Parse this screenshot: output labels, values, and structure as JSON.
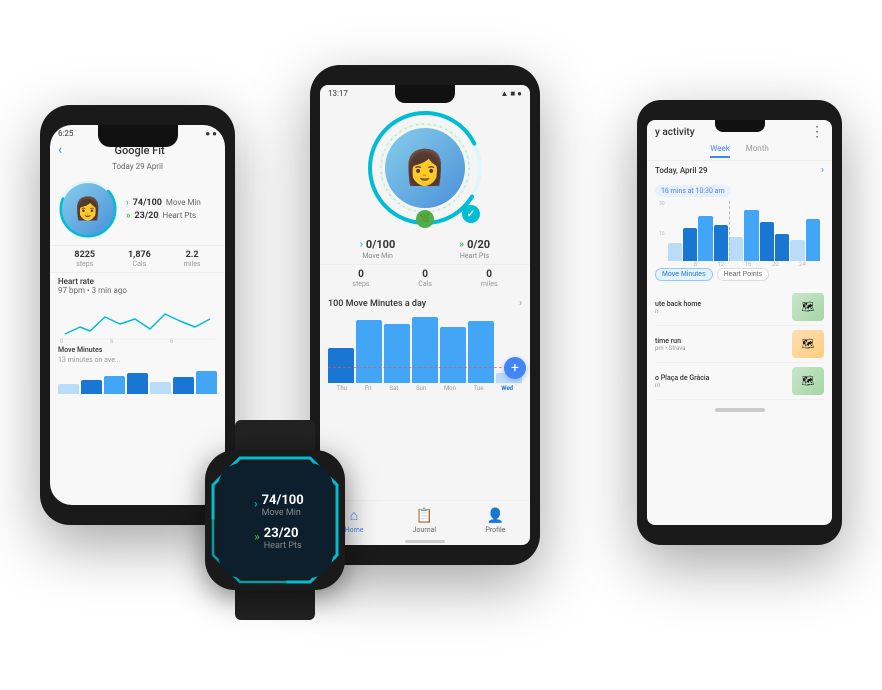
{
  "left_phone": {
    "status_time": "6:25",
    "title": "Google Fit",
    "date": "Today 29 April",
    "metrics": {
      "move_min": "74",
      "move_min_total": "100",
      "move_min_label": "Move Min",
      "heart_pts": "23",
      "heart_pts_total": "20",
      "heart_pts_label": "Heart Pts"
    },
    "steps": "8225",
    "steps_label": "steps",
    "cals": "1,876",
    "cals_label": "Cals",
    "miles": "2.2",
    "miles_label": "miles",
    "heart_rate_title": "Heart rate",
    "heart_rate_val": "97 bpm • 3 min ago",
    "move_minutes_label": "Move Minutes",
    "move_minutes_sub": "13 minutes on ave..."
  },
  "center_phone": {
    "status_time": "13:17",
    "metrics": {
      "move_min": "0",
      "move_min_total": "100",
      "move_min_label": "Move Min",
      "heart_pts": "0",
      "heart_pts_total": "20",
      "heart_pts_label": "Heart Pts"
    },
    "steps": "0",
    "steps_label": "steps",
    "cals": "0",
    "cals_label": "Cals",
    "miles": "0",
    "miles_label": "miles",
    "move_section_label": "100 Move Minutes a day",
    "chart_days": [
      "Thu",
      "Fri",
      "Sat",
      "Sun",
      "Mon",
      "Tue",
      "Wed"
    ],
    "nav": {
      "home": "Home",
      "journal": "Journal",
      "profile": "Profile"
    }
  },
  "right_phone": {
    "title": "y activity",
    "tabs": [
      "Week",
      "Month"
    ],
    "active_tab": "Week",
    "date": "Today, April 29",
    "activity_badge": "16 mins at 10:30 am",
    "chart_x_labels": [
      "",
      "8",
      "12",
      "16",
      "20",
      "24"
    ],
    "filter_buttons": [
      "Move Minutes",
      "Heart Points"
    ],
    "active_filter": "Move Minutes",
    "activities": [
      {
        "name": "ute back home",
        "meta": "n",
        "map_type": "green"
      },
      {
        "name": "time run",
        "meta": "pm • Strava",
        "map_type": "orange"
      },
      {
        "name": "o Plaça de Gràcia",
        "meta": "m",
        "map_type": "green"
      }
    ]
  },
  "watch": {
    "move_min": "74",
    "move_min_total": "100",
    "move_min_label": "Move Min",
    "heart_pts": "23",
    "heart_pts_total": "20",
    "heart_pts_label": "Heart Pts"
  }
}
